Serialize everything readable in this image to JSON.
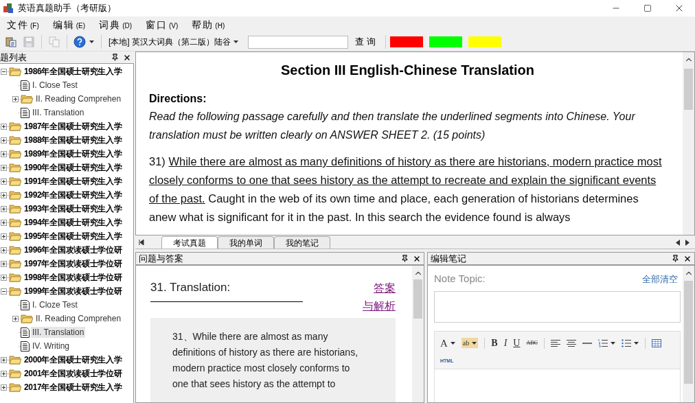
{
  "window": {
    "title": "英语真题助手（考研版）"
  },
  "menu": [
    {
      "label": "文件",
      "hotkey": "(F)"
    },
    {
      "label": "编辑",
      "hotkey": "(E)"
    },
    {
      "label": "词典",
      "hotkey": "(D)"
    },
    {
      "label": "窗口",
      "hotkey": "(V)"
    },
    {
      "label": "帮助",
      "hotkey": "(H)"
    }
  ],
  "toolbar": {
    "buttons": [
      {
        "kind": "paste",
        "disabled": false
      },
      {
        "kind": "save",
        "disabled": true
      },
      {
        "kind": "copy",
        "disabled": true
      },
      {
        "kind": "help",
        "disabled": false
      }
    ],
    "dictionary": "[本地] 英汉大词典（第二版）陆谷",
    "search_button": "查 询",
    "highlight_colors": [
      {
        "color": "#ff0000"
      },
      {
        "color": "#00ff00"
      },
      {
        "color": "#ffff00"
      }
    ]
  },
  "question_list": {
    "title": "题列表",
    "tree": [
      {
        "label": "1986年全国硕士研究生入学",
        "kind": "folder",
        "expanded": true,
        "selected": false,
        "children": [
          {
            "label": "I. Close Test",
            "kind": "doc",
            "selected": false
          },
          {
            "label": "II. Reading Comprehen",
            "kind": "folder",
            "expanded": false,
            "selected": false
          },
          {
            "label": "III. Translation",
            "kind": "doc",
            "selected": false
          }
        ]
      },
      {
        "label": "1987年全国硕士研究生入学",
        "kind": "folder",
        "expanded": false,
        "selected": false
      },
      {
        "label": "1988年全国硕士研究生入学",
        "kind": "folder",
        "expanded": false,
        "selected": false
      },
      {
        "label": "1989年全国硕士研究生入学",
        "kind": "folder",
        "expanded": false,
        "selected": false
      },
      {
        "label": "1990年全国硕士研究生入学",
        "kind": "folder",
        "expanded": false,
        "selected": false
      },
      {
        "label": "1991年全国硕士研究生入学",
        "kind": "folder",
        "expanded": false,
        "selected": false
      },
      {
        "label": "1992年全国硕士研究生入学",
        "kind": "folder",
        "expanded": false,
        "selected": false
      },
      {
        "label": "1993年全国硕士研究生入学",
        "kind": "folder",
        "expanded": false,
        "selected": false
      },
      {
        "label": "1994年全国硕士研究生入学",
        "kind": "folder",
        "expanded": false,
        "selected": false
      },
      {
        "label": "1995年全国硕士研究生入学",
        "kind": "folder",
        "expanded": false,
        "selected": false
      },
      {
        "label": "1996年全国攻读硕士学位研",
        "kind": "folder",
        "expanded": false,
        "selected": false
      },
      {
        "label": "1997年全国攻读硕士学位研",
        "kind": "folder",
        "expanded": false,
        "selected": false
      },
      {
        "label": "1998年全国攻读硕士学位研",
        "kind": "folder",
        "expanded": false,
        "selected": false
      },
      {
        "label": "1999年全国攻读硕士学位研",
        "kind": "folder",
        "expanded": true,
        "selected": false,
        "children": [
          {
            "label": "I. Cloze Test",
            "kind": "doc",
            "selected": false
          },
          {
            "label": "II. Reading Comprehen",
            "kind": "folder",
            "expanded": false,
            "selected": false
          },
          {
            "label": "III. Translation",
            "kind": "doc",
            "selected": true
          },
          {
            "label": "IV. Writing",
            "kind": "doc",
            "selected": false
          }
        ]
      },
      {
        "label": "2000年全国硕士研究生入学",
        "kind": "folder",
        "expanded": false,
        "selected": false
      },
      {
        "label": "2001年全国攻读硕士学位研",
        "kind": "folder",
        "expanded": false,
        "selected": false
      },
      {
        "label": "2017年全国硕士研究生入学",
        "kind": "folder",
        "expanded": false,
        "selected": false
      }
    ]
  },
  "document": {
    "heading": "Section III English-Chinese Translation",
    "directions_label": "Directions:",
    "directions": "Read the following passage carefully and then translate the underlined segments into Chinese. Your translation must be written clearly on ANSWER SHEET 2. (15 points)",
    "passage": {
      "number": "31)",
      "underlined": "While there are almost as many definitions of history as there are historians, modern practice most closely conforms to one that sees history as the attempt to recreate and explain the significant events of the past.",
      "rest": "Caught in the web of its own time and place, each generation of historians determines anew what is significant for it in the past. In this search the evidence found is always"
    }
  },
  "tabs": [
    {
      "label": "考试真题",
      "selected": true
    },
    {
      "label": "我的单词",
      "selected": false
    },
    {
      "label": "我的笔记",
      "selected": false
    }
  ],
  "qa_panel": {
    "title": "问题与答案",
    "question": "31. Translation:",
    "answer_link": [
      "答案",
      "与解析"
    ],
    "excerpt": "31、While there are almost as many definitions of history as there are historians, modern practice most closely conforms to one that sees history as the attempt to"
  },
  "notes_panel": {
    "title": "编辑笔记",
    "topic_label": "Note Topic:",
    "clear_link": "全部清空",
    "format_glyphs": {
      "font_color": "A",
      "highlight": "ab",
      "bold": "B",
      "italic": "I",
      "underline": "U",
      "strike": "ABC"
    },
    "mode": "HTML"
  }
}
